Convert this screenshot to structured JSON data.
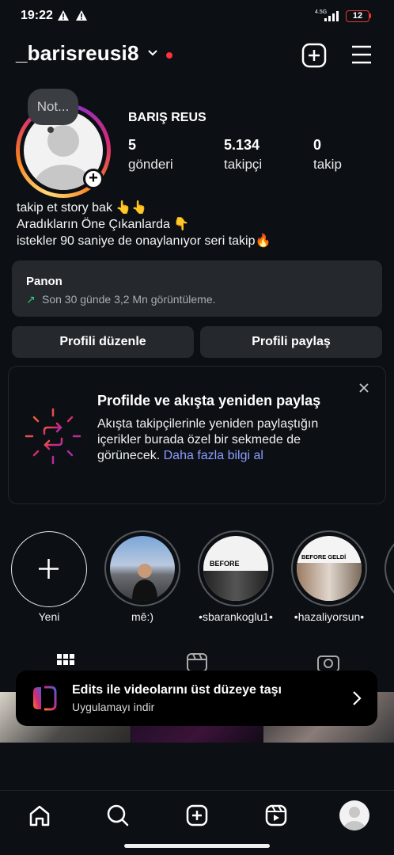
{
  "status_bar": {
    "time": "19:22",
    "network": "4.5G",
    "battery": "12"
  },
  "header": {
    "username": "_barisreusi8"
  },
  "note": {
    "text": "Not..."
  },
  "profile": {
    "display_name": "BARIŞ REUS",
    "stats": [
      {
        "value": "5",
        "label": "gönderi"
      },
      {
        "value": "5.134",
        "label": "takipçi"
      },
      {
        "value": "0",
        "label": "takip"
      }
    ],
    "bio": [
      "takip et story bak 👆👆",
      "Aradıkların Öne Çıkanlarda 👇",
      "istekler 90 saniye de onaylanıyor seri takip🔥"
    ]
  },
  "dashboard": {
    "title": "Panon",
    "arrow": "↗",
    "subtitle": "Son 30 günde 3,2 Mn görüntüleme."
  },
  "buttons": {
    "edit_profile": "Profili düzenle",
    "share_profile": "Profili paylaş"
  },
  "reshare_card": {
    "title": "Profilde ve akışta yeniden paylaş",
    "body": "Akışta takipçilerinle yeniden paylaştığın içerikler burada özel bir sekmede de görünecek.",
    "link": "Daha fazla bilgi al"
  },
  "highlights": [
    {
      "label": "Yeni"
    },
    {
      "label": "mê:)"
    },
    {
      "label": "•sbarankoglu1•"
    },
    {
      "label": "•hazaliyorsun•"
    }
  ],
  "highlight_thumbs": {
    "before": "BEFORE",
    "before_geldi": "BEFORE GELDİ"
  },
  "edits_banner": {
    "title": "Edits ile videolarını üst düzeye taşı",
    "subtitle": "Uygulamayı indir"
  },
  "colors": {
    "background": "#0c1014",
    "card": "#25292e",
    "accent_link": "#8b9cff",
    "notification_dot": "#ff3040"
  },
  "icons": {
    "header": [
      "add-post-icon",
      "menu-icon"
    ],
    "nav": [
      "home-icon",
      "search-icon",
      "create-icon",
      "reels-icon",
      "profile-avatar-icon"
    ]
  }
}
